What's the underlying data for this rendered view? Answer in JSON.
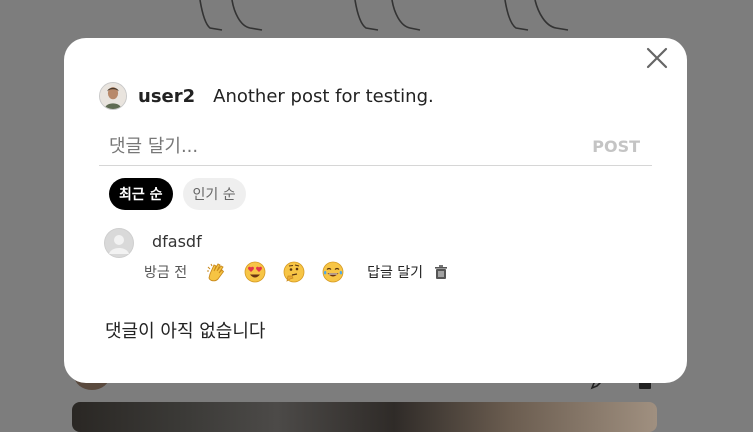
{
  "post": {
    "username": "user2",
    "caption": "Another post for testing."
  },
  "comment_form": {
    "placeholder": "댓글 달기...",
    "value": "",
    "post_label": "POST"
  },
  "sort": {
    "recent_label": "최근 순",
    "popular_label": "인기 순",
    "selected": "최근 순"
  },
  "comments": [
    {
      "text": "dfasdf",
      "time": "방금 전",
      "reactions": [
        "clapping-hands",
        "heart-eyes",
        "thinking-face",
        "tears-of-joy"
      ],
      "reply_label": "답글 달기"
    }
  ],
  "empty_message": "댓글이 아직 없습니다",
  "colors": {
    "overlay": "#7d7d7d",
    "active_chip": "#000000",
    "inactive_chip": "#efefef",
    "post_button": "#c4c4c4"
  }
}
